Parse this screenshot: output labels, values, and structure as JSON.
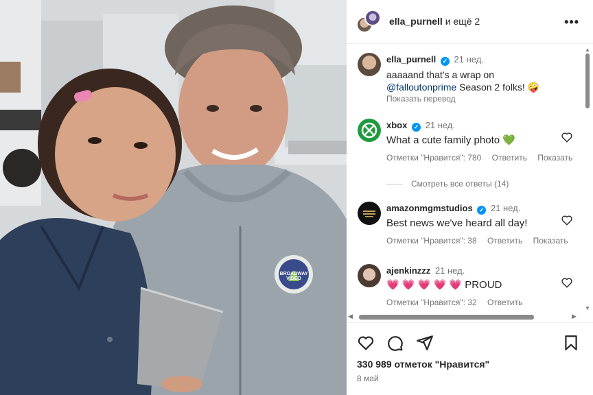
{
  "header": {
    "username": "ella_purnell",
    "suffix": "и ещё 2",
    "more_icon": "more-horizontal-icon"
  },
  "comments": [
    {
      "username": "ella_purnell",
      "verified": true,
      "ago": "21 нед.",
      "text_pre": "aaaaand that’s a wrap on",
      "mention": "@falloutonprime",
      "text_post": " Season 2 folks! 🤪",
      "translate": "Показать перевод"
    },
    {
      "username": "xbox",
      "verified": true,
      "ago": "21 нед.",
      "text": "What a cute family photo 💚",
      "likes": "Отметки \"Нравится\": 780",
      "reply": "Ответить",
      "translate": "Показать",
      "view_replies": "Смотреть все ответы (14)"
    },
    {
      "username": "amazonmgmstudios",
      "verified": true,
      "ago": "21 нед.",
      "text": "Best news we've heard all day!",
      "likes": "Отметки \"Нравится\": 38",
      "reply": "Ответить",
      "translate": "Показать"
    },
    {
      "username": "ajenkinzzz",
      "verified": false,
      "ago": "21 нед.",
      "text": "💗 💗 💗 💗 💗 PROUD",
      "likes": "Отметки \"Нравится\": 32",
      "reply": "Ответить"
    }
  ],
  "footer": {
    "likes": "330 989 отметок \"Нравится\"",
    "date": "8 май",
    "icons": [
      "heart-icon",
      "comment-icon",
      "share-icon",
      "bookmark-icon"
    ]
  },
  "photo": {
    "logo_text": "BROADWAY VIDEO"
  }
}
